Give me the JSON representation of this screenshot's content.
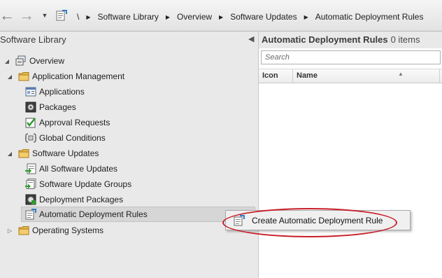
{
  "navigation": {
    "back_icon": "back-arrow-icon",
    "forward_icon": "forward-arrow-icon",
    "breadcrumb_root": "\\",
    "breadcrumbs": [
      "Software Library",
      "Overview",
      "Software Updates",
      "Automatic Deployment Rules"
    ]
  },
  "left_pane": {
    "title": "Software Library",
    "tree": [
      {
        "label": "Overview",
        "icon": "overview-icon"
      },
      {
        "label": "Application Management",
        "icon": "folder-icon"
      },
      {
        "label": "Applications",
        "icon": "applications-icon"
      },
      {
        "label": "Packages",
        "icon": "packages-icon"
      },
      {
        "label": "Approval Requests",
        "icon": "approval-requests-icon"
      },
      {
        "label": "Global Conditions",
        "icon": "global-conditions-icon"
      },
      {
        "label": "Software Updates",
        "icon": "folder-icon"
      },
      {
        "label": "All Software Updates",
        "icon": "software-updates-icon"
      },
      {
        "label": "Software Update Groups",
        "icon": "update-groups-icon"
      },
      {
        "label": "Deployment Packages",
        "icon": "deployment-packages-icon"
      },
      {
        "label": "Automatic Deployment Rules",
        "icon": "deployment-rules-icon",
        "selected": true
      },
      {
        "label": "Operating Systems",
        "icon": "folder-icon"
      }
    ]
  },
  "right_pane": {
    "title": "Automatic Deployment Rules",
    "count": "0 items",
    "search_placeholder": "Search",
    "columns": [
      "Icon",
      "Name"
    ]
  },
  "context_menu": {
    "items": [
      {
        "label": "Create Automatic Deployment Rule",
        "icon": "deployment-rule-icon"
      }
    ]
  },
  "colors": {
    "annotation_ellipse": "#c8202a",
    "folder": "#e8b84a",
    "selection": "#d6d6d6"
  }
}
